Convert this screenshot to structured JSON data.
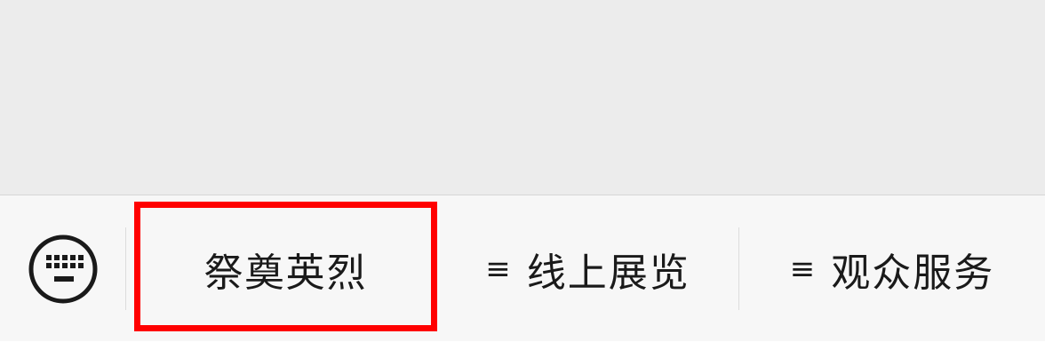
{
  "menu": {
    "keyboard_icon": "keyboard-icon",
    "items": [
      {
        "label": "祭奠英烈",
        "has_submenu": false
      },
      {
        "label": "线上展览",
        "has_submenu": true,
        "glyph": "≡"
      },
      {
        "label": "观众服务",
        "has_submenu": true,
        "glyph": "≡"
      }
    ]
  },
  "colors": {
    "content_bg": "#ececec",
    "menu_bg": "#f7f7f7",
    "highlight": "#ff0000",
    "text": "#1a1a1a"
  }
}
